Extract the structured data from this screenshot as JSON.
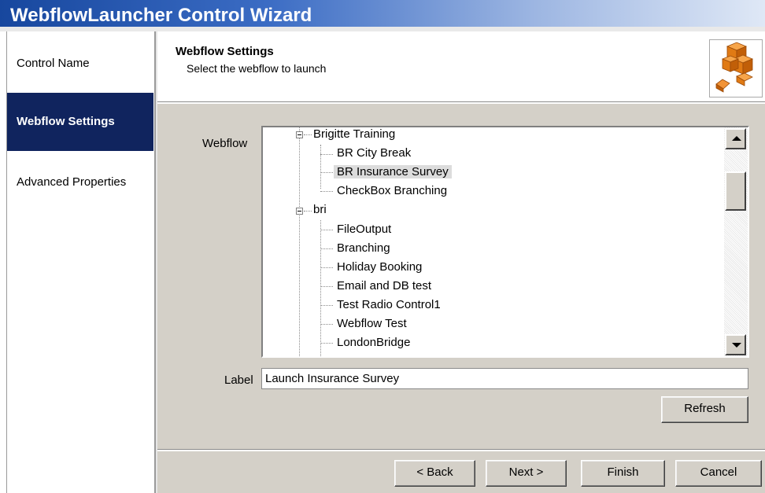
{
  "window": {
    "title": "WebflowLauncher Control Wizard"
  },
  "nav": {
    "items": [
      {
        "label": "Control Name",
        "active": false
      },
      {
        "label": "Webflow Settings",
        "active": true
      },
      {
        "label": "Advanced Properties",
        "active": false
      }
    ]
  },
  "header": {
    "title": "Webflow Settings",
    "subtitle": "Select the webflow to launch",
    "logo_icon": "orange-cubes-icon"
  },
  "form": {
    "webflow_label": "Webflow",
    "label_label": "Label",
    "label_value": "Launch Insurance Survey"
  },
  "tree": {
    "groups": [
      {
        "name": "Brigitte Training",
        "children": [
          "BR City Break",
          "BR Insurance Survey",
          "CheckBox Branching"
        ]
      },
      {
        "name": "bri",
        "children": [
          "FileOutput",
          "Branching",
          "Holiday Booking",
          "Email and DB test",
          "Test Radio Control1",
          "Webflow Test",
          "LondonBridge"
        ]
      }
    ],
    "selected": "BR Insurance Survey"
  },
  "buttons": {
    "refresh": "Refresh",
    "back": "< Back",
    "next": "Next >",
    "finish": "Finish",
    "cancel": "Cancel"
  },
  "colors": {
    "title_gradient_start": "#17479e",
    "nav_active_bg": "#10245e",
    "panel_bg": "#d4d0c8",
    "logo_orange": "#e8781a"
  }
}
